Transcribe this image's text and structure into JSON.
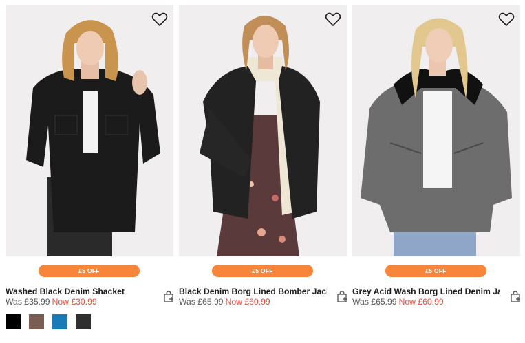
{
  "products": [
    {
      "title": "Washed Black Denim Shacket",
      "promo": "£5 OFF",
      "was": "Was £35.99",
      "now": "Now £30.99",
      "swatches": [
        "#000000",
        "#7a5d52",
        "#1a7bb8",
        "#2f2f2f"
      ],
      "jacket_color": "#1b1b1b",
      "hair_color": "#c9954e"
    },
    {
      "title": "Black Denim Borg Lined Bomber Jacket",
      "promo": "£5 OFF",
      "was": "Was £65.99",
      "now": "Now £60.99",
      "jacket_color": "#222222",
      "hair_color": "#c08e56"
    },
    {
      "title": "Grey Acid Wash Borg Lined Denim Jacket",
      "promo": "£5 OFF",
      "was": "Was £65.99",
      "now": "Now £60.99",
      "jacket_color": "#6d6d6d",
      "hair_color": "#e2c88e"
    }
  ],
  "icons": {
    "wishlist": "heart-icon",
    "add_to_bag": "bag-plus-icon"
  },
  "colors": {
    "promo_bg": "#f7863a",
    "sale_price": "#e54b3d",
    "image_bg": "#f0eeee"
  }
}
